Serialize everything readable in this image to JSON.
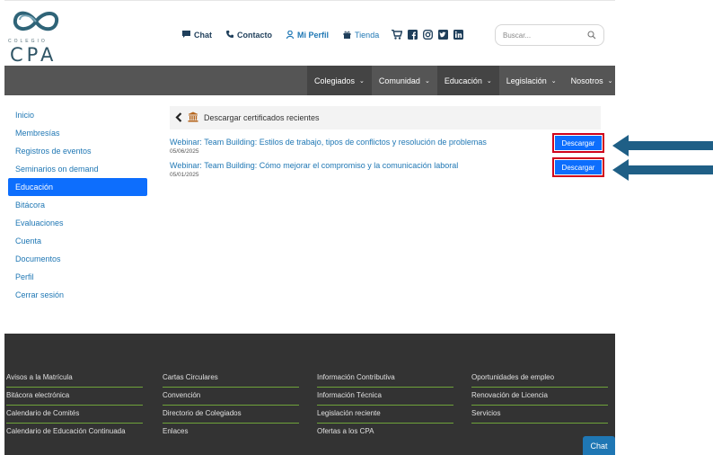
{
  "logo": {
    "sub": "COLEGIO",
    "main": "CPA"
  },
  "topnav": {
    "chat": "Chat",
    "contacto": "Contacto",
    "perfil": "Mi Perfil",
    "tienda": "Tienda"
  },
  "search": {
    "placeholder": "Buscar..."
  },
  "mainnav": {
    "items": [
      {
        "label": "Colegiados"
      },
      {
        "label": "Comunidad"
      },
      {
        "label": "Educación"
      },
      {
        "label": "Legislación"
      },
      {
        "label": "Nosotros"
      }
    ]
  },
  "sidebar": {
    "items": [
      {
        "label": "Inicio"
      },
      {
        "label": "Membresías"
      },
      {
        "label": "Registros de eventos"
      },
      {
        "label": "Seminarios on demand"
      },
      {
        "label": "Educación"
      },
      {
        "label": "Bitácora"
      },
      {
        "label": "Evaluaciones"
      },
      {
        "label": "Cuenta"
      },
      {
        "label": "Documentos"
      },
      {
        "label": "Perfil"
      },
      {
        "label": "Cerrar sesión"
      }
    ]
  },
  "content": {
    "title": "Descargar certificados recientes",
    "rows": [
      {
        "title": "Webinar: Team Building: Estilos de trabajo, tipos de conflictos y resolución de problemas",
        "date": "05/06/2025",
        "button": "Descargar"
      },
      {
        "title": "Webinar: Team Building: Cómo mejorar el compromiso y la comunicación laboral",
        "date": "05/01/2025",
        "button": "Descargar"
      }
    ]
  },
  "footer": {
    "col1": [
      "Avisos a la Matrícula",
      "Bitácora electrónica",
      "Calendario de Comités",
      "Calendario de Educación Continuada"
    ],
    "col2": [
      "Cartas Circulares",
      "Convención",
      "Directorio de Colegiados",
      "Enlaces"
    ],
    "col3": [
      "Información Contributiva",
      "Información Técnica",
      "Legislación reciente",
      "Ofertas a los CPA"
    ],
    "col4": [
      "Oportunidades de empleo",
      "Renovación de Licencia",
      "Servicios"
    ]
  },
  "chat_button": "Chat",
  "colors": {
    "primary": "#0d6efd",
    "link": "#1f77b4",
    "nav_bg": "#555555",
    "footer_bg": "#333333",
    "highlight": "#d0021b",
    "arrow": "#1f5f86"
  }
}
